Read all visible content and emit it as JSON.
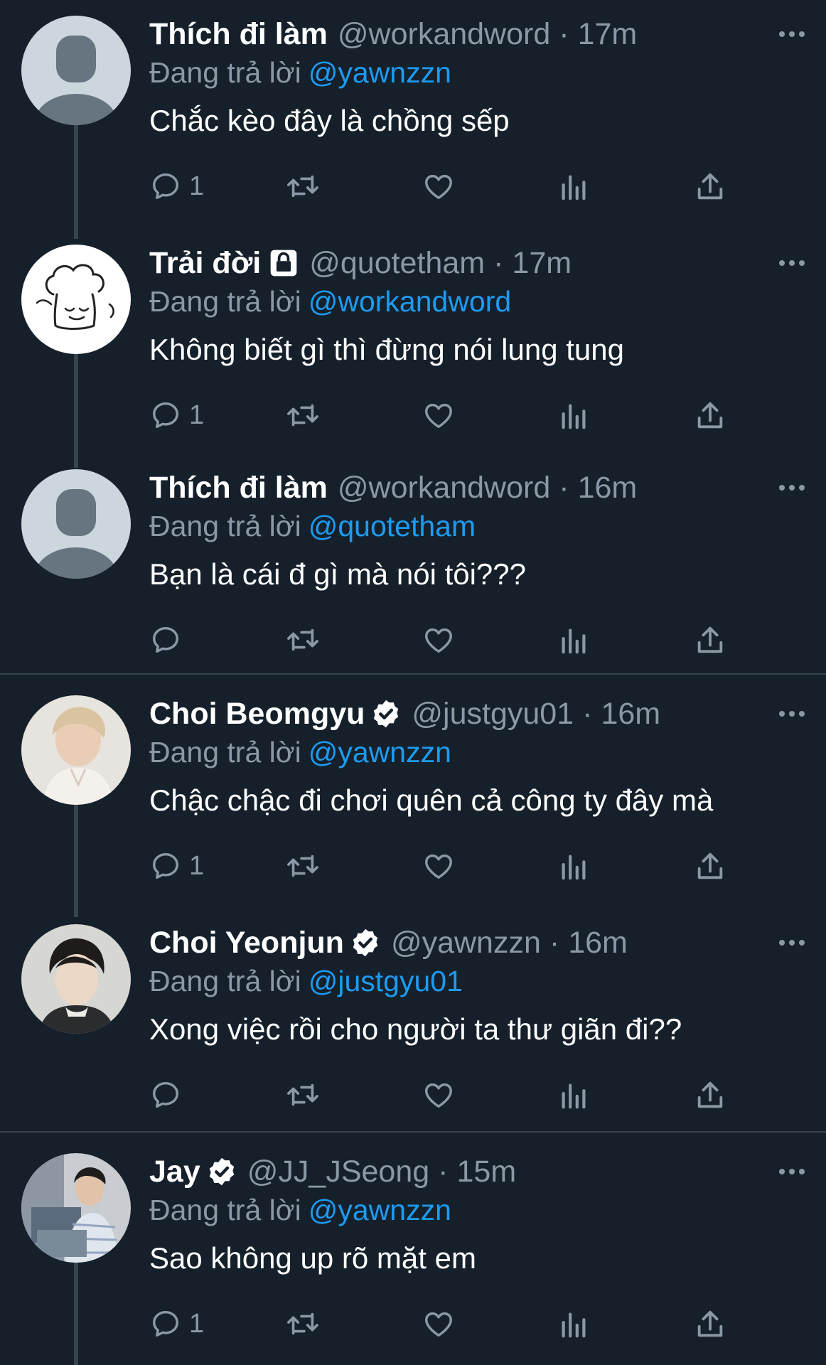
{
  "theme": {
    "background": "#15202b",
    "secondary_text": "#8b98a5",
    "link": "#1d9bf0",
    "divider": "#38444d",
    "verified_badge": "#ffffff"
  },
  "labels": {
    "replying_to": "Đang trả lời"
  },
  "tweets": [
    {
      "name": "Thích đi làm",
      "handle": "@workandword",
      "time": "17m",
      "badge": "",
      "reply_to": "@yawnzzn",
      "text": "Chắc kèo đây là chồng sếp",
      "reply_count": "1",
      "avatar": "default-avatar"
    },
    {
      "name": "Trải đời",
      "handle": "@quotetham",
      "time": "17m",
      "badge": "lock-icon",
      "reply_to": "@workandword",
      "text": "Không biết gì thì đừng nói lung tung",
      "reply_count": "1",
      "avatar": "chef-doodle-avatar"
    },
    {
      "name": "Thích đi làm",
      "handle": "@workandword",
      "time": "16m",
      "badge": "",
      "reply_to": "@quotetham",
      "text": "Bạn là cái đ gì mà nói tôi???",
      "reply_count": "",
      "avatar": "default-avatar"
    },
    {
      "name": "Choi Beomgyu",
      "handle": "@justgyu01",
      "time": "16m",
      "badge": "verified-icon",
      "reply_to": "@yawnzzn",
      "text": "Chậc chậc đi chơi quên cả công ty đây mà",
      "reply_count": "1",
      "avatar": "photo-avatar"
    },
    {
      "name": "Choi Yeonjun",
      "handle": "@yawnzzn",
      "time": "16m",
      "badge": "verified-icon",
      "reply_to": "@justgyu01",
      "text": "Xong việc rồi cho người ta thư giãn đi??",
      "reply_count": "",
      "avatar": "photo-avatar"
    },
    {
      "name": "Jay",
      "handle": "@JJ_JSeong",
      "time": "15m",
      "badge": "verified-icon",
      "reply_to": "@yawnzzn",
      "text": "Sao không up rõ mặt em",
      "reply_count": "1",
      "avatar": "photo-avatar"
    }
  ]
}
